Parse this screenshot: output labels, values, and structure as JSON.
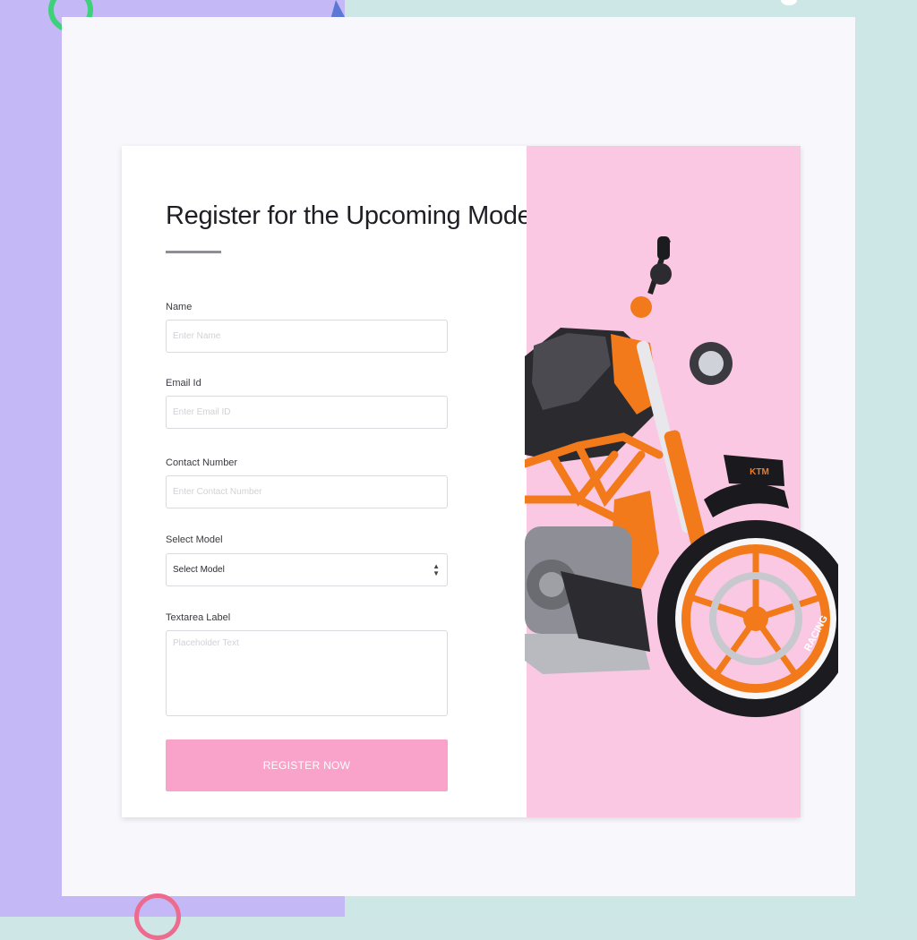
{
  "form": {
    "title": "Register for the Upcoming Model",
    "fields": [
      {
        "label": "Name",
        "placeholder": "Enter Name",
        "value": ""
      },
      {
        "label": "Email Id",
        "placeholder": "Enter Email ID",
        "value": ""
      },
      {
        "label": "Contact Number",
        "placeholder": "Enter Contact Number",
        "value": ""
      }
    ],
    "select": {
      "label": "Select Model",
      "selected": "Select Model"
    },
    "textarea": {
      "label": "Textarea Label",
      "placeholder": "Placeholder Text",
      "value": ""
    },
    "submit_label": "REGISTER NOW"
  },
  "image": {
    "subject": "motorcycle-image",
    "brand_badge": "KTM",
    "wheel_text": "RACING"
  },
  "colors": {
    "accent_pink": "#f9a3cb",
    "image_panel_bg": "#fbc8e4",
    "bg_lavender": "#c4b9f6",
    "bg_mint": "#cde7e6",
    "moto_orange": "#f27a1a"
  }
}
